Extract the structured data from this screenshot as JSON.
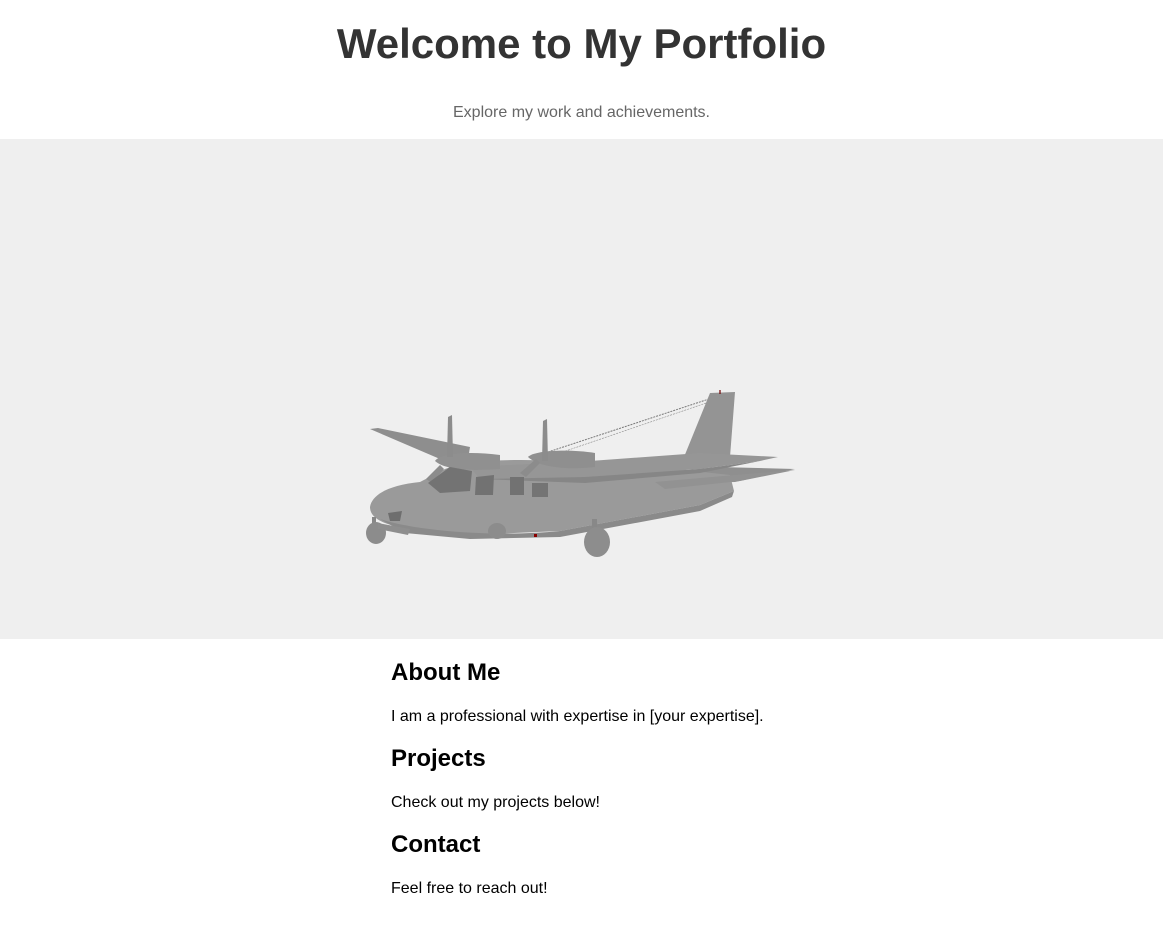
{
  "header": {
    "title": "Welcome to My Portfolio",
    "subtitle": "Explore my work and achievements."
  },
  "viewer": {
    "model": "airplane-model",
    "background_color": "#efefef",
    "model_color": "#999999"
  },
  "sections": [
    {
      "title": "About Me",
      "text": "I am a professional with expertise in [your expertise]."
    },
    {
      "title": "Projects",
      "text": "Check out my projects below!"
    },
    {
      "title": "Contact",
      "text": "Feel free to reach out!"
    }
  ]
}
